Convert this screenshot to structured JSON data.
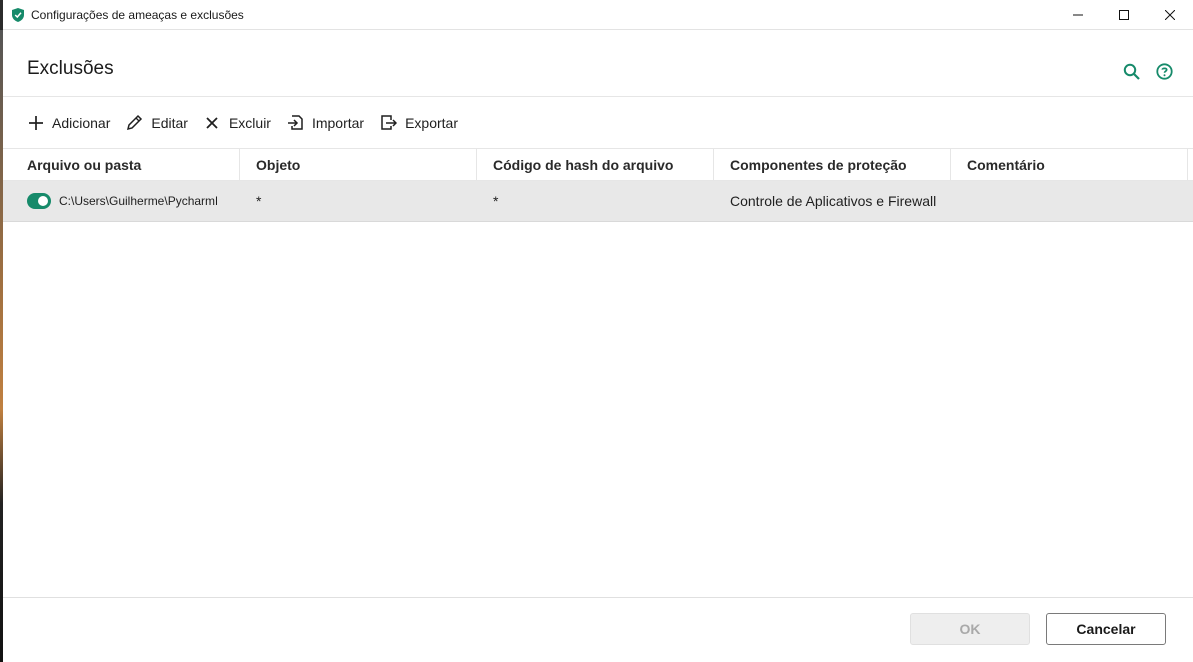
{
  "window": {
    "title": "Configurações de ameaças e exclusões",
    "controls": {
      "minimize": "—",
      "maximize": "☐",
      "close": "✕"
    }
  },
  "header": {
    "title": "Exclusões",
    "accent_color": "#168a6a"
  },
  "toolbar": {
    "add_label": "Adicionar",
    "edit_label": "Editar",
    "delete_label": "Excluir",
    "import_label": "Importar",
    "export_label": "Exportar"
  },
  "table": {
    "columns": [
      "Arquivo ou pasta",
      "Objeto",
      "Código de hash do arquivo",
      "Componentes de proteção",
      "Comentário"
    ],
    "rows": [
      {
        "enabled": true,
        "path": "C:\\Users\\Guilherme\\PycharmP",
        "object": "*",
        "hash": "*",
        "components": "Controle de Aplicativos e Firewall",
        "comment": ""
      }
    ]
  },
  "footer": {
    "ok_label": "OK",
    "cancel_label": "Cancelar"
  }
}
